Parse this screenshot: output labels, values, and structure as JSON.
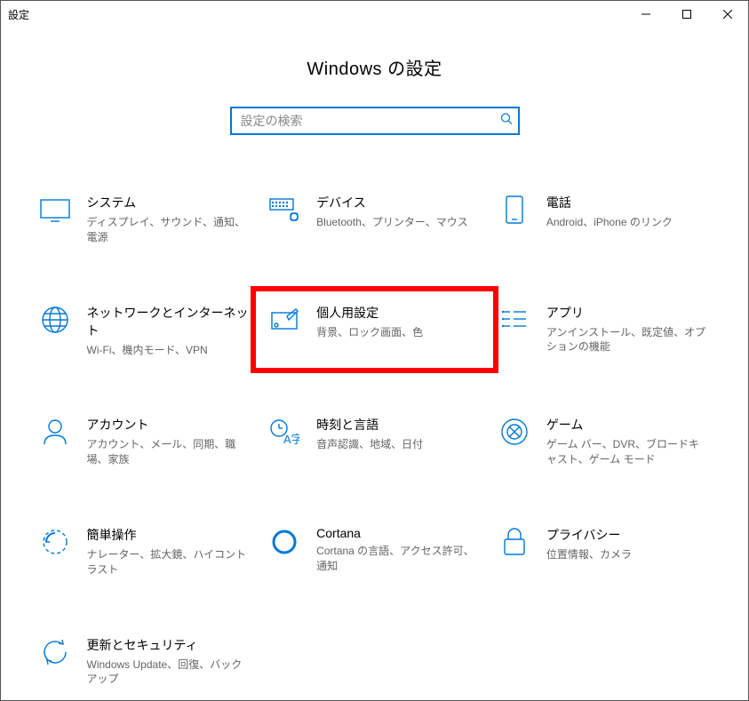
{
  "window": {
    "title": "設定"
  },
  "header": {
    "page_title": "Windows の設定",
    "search_placeholder": "設定の検索"
  },
  "tiles": [
    {
      "id": "system",
      "title": "システム",
      "desc": "ディスプレイ、サウンド、通知、電源"
    },
    {
      "id": "devices",
      "title": "デバイス",
      "desc": "Bluetooth、プリンター、マウス"
    },
    {
      "id": "phone",
      "title": "電話",
      "desc": "Android、iPhone のリンク"
    },
    {
      "id": "network",
      "title": "ネットワークとインターネット",
      "desc": "Wi-Fi、機内モード、VPN"
    },
    {
      "id": "personalization",
      "title": "個人用設定",
      "desc": "背景、ロック画面、色",
      "highlight": true
    },
    {
      "id": "apps",
      "title": "アプリ",
      "desc": "アンインストール、既定値、オプションの機能"
    },
    {
      "id": "accounts",
      "title": "アカウント",
      "desc": "アカウント、メール、同期、職場、家族"
    },
    {
      "id": "time",
      "title": "時刻と言語",
      "desc": "音声認識、地域、日付"
    },
    {
      "id": "gaming",
      "title": "ゲーム",
      "desc": "ゲーム バー、DVR、ブロードキャスト、ゲーム モード"
    },
    {
      "id": "ease",
      "title": "簡単操作",
      "desc": "ナレーター、拡大鏡、ハイコントラスト"
    },
    {
      "id": "cortana",
      "title": "Cortana",
      "desc": "Cortana の言語、アクセス許可、通知"
    },
    {
      "id": "privacy",
      "title": "プライバシー",
      "desc": "位置情報、カメラ"
    },
    {
      "id": "update",
      "title": "更新とセキュリティ",
      "desc": "Windows Update、回復、バックアップ"
    }
  ]
}
